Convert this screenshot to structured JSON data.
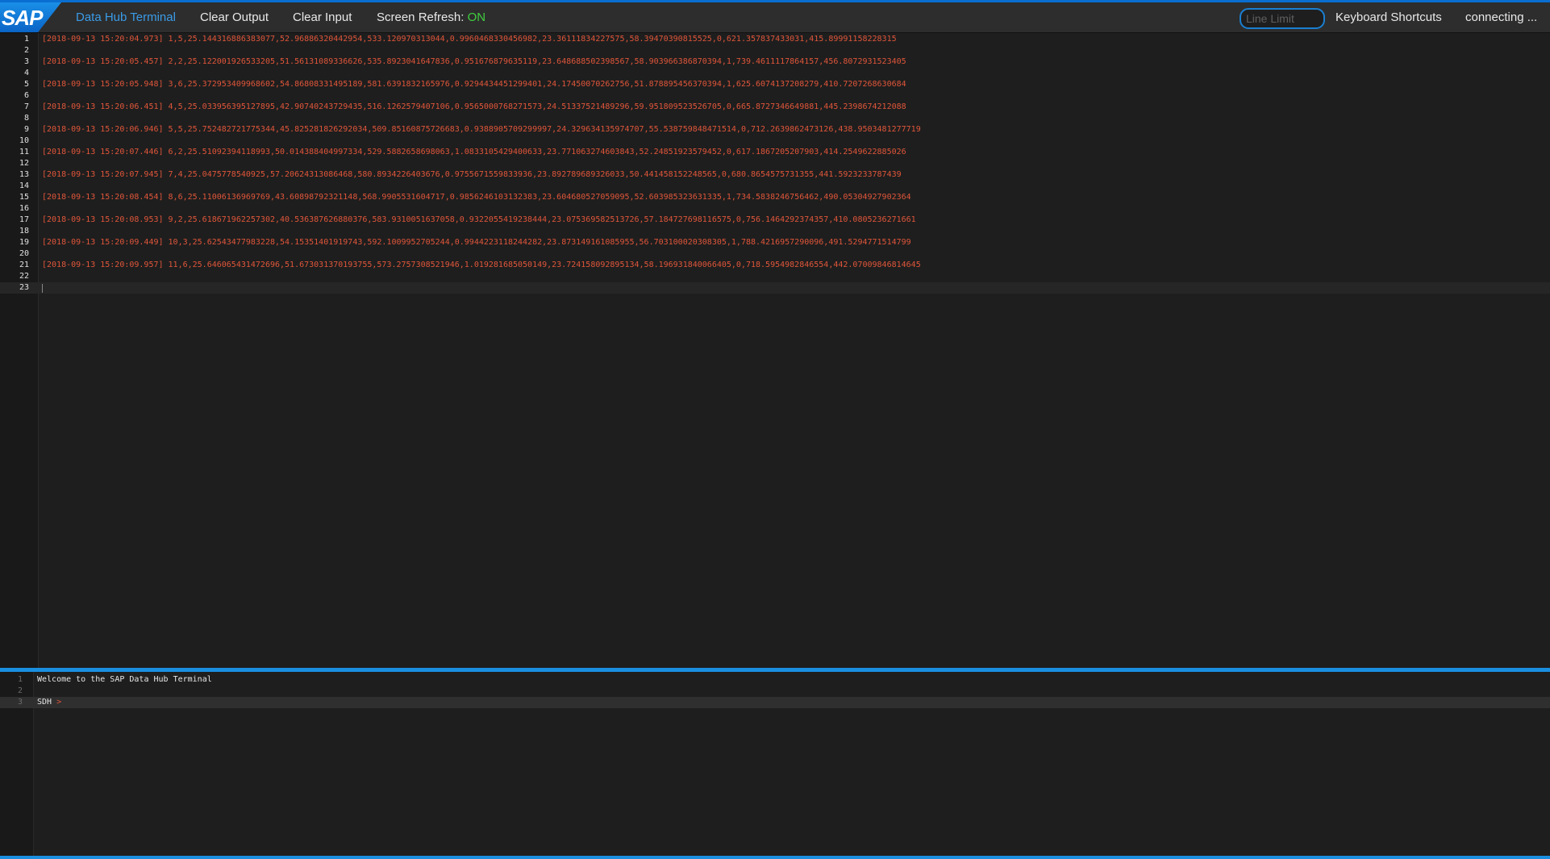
{
  "header": {
    "logo_text": "SAP",
    "title": "Data Hub Terminal",
    "clear_output": "Clear Output",
    "clear_input": "Clear Input",
    "screen_refresh_label": "Screen Refresh:",
    "screen_refresh_value": "ON",
    "line_limit_placeholder": "Line Limit",
    "keyboard_shortcuts": "Keyboard Shortcuts",
    "connection_status": "connecting ..."
  },
  "output": {
    "line_numbers": [
      "1",
      "2",
      "3",
      "4",
      "5",
      "6",
      "7",
      "8",
      "9",
      "10",
      "11",
      "12",
      "13",
      "14",
      "15",
      "16",
      "17",
      "18",
      "19",
      "20",
      "21",
      "22",
      "23"
    ],
    "lines": [
      "[2018-09-13 15:20:04.973] 1,5,25.144316886383077,52.96886320442954,533.120970313044,0.9960468330456982,23.36111834227575,58.39470390815525,0,621.357837433031,415.89991158228315",
      "",
      "[2018-09-13 15:20:05.457] 2,2,25.122001926533205,51.56131089336626,535.8923041647836,0.951676879635119,23.648688502398567,58.903966386870394,1,739.4611117864157,456.8072931523405",
      "",
      "[2018-09-13 15:20:05.948] 3,6,25.372953409968602,54.86808331495189,581.6391832165976,0.9294434451299401,24.17450070262756,51.878895456370394,1,625.6074137208279,410.7207268630684",
      "",
      "[2018-09-13 15:20:06.451] 4,5,25.033956395127895,42.90740243729435,516.1262579407106,0.9565000768271573,24.51337521489296,59.951809523526705,0,665.8727346649881,445.2398674212088",
      "",
      "[2018-09-13 15:20:06.946] 5,5,25.752482721775344,45.825281826292034,509.85160875726683,0.9388905709299997,24.329634135974707,55.538759848471514,0,712.2639862473126,438.9503481277719",
      "",
      "[2018-09-13 15:20:07.446] 6,2,25.51092394118993,50.014388404997334,529.5882658698063,1.0833105429400633,23.771063274603843,52.24851923579452,0,617.1867205207903,414.2549622885026",
      "",
      "[2018-09-13 15:20:07.945] 7,4,25.0475778540925,57.20624313086468,580.8934226403676,0.9755671559833936,23.892789689326033,50.441458152248565,0,680.8654575731355,441.5923233787439",
      "",
      "[2018-09-13 15:20:08.454] 8,6,25.11006136969769,43.60898792321148,568.9905531604717,0.9856246103132383,23.604680527059095,52.603985323631335,1,734.5838246756462,490.05304927902364",
      "",
      "[2018-09-13 15:20:08.953] 9,2,25.618671962257302,40.536387626880376,583.9310051637058,0.9322055419238444,23.075369582513726,57.184727698116575,0,756.1464292374357,410.0805236271661",
      "",
      "[2018-09-13 15:20:09.449] 10,3,25.62543477983228,54.15351401919743,592.1009952705244,0.9944223118244282,23.873149161085955,56.703100020308305,1,788.4216957290096,491.5294771514799",
      "",
      "[2018-09-13 15:20:09.957] 11,6,25.646065431472696,51.673031370193755,573.2757308521946,1.019281685050149,23.724158092895134,58.196931840066405,0,718.5954982846554,442.07009846814645",
      "",
      ""
    ]
  },
  "input": {
    "line_numbers": [
      "1",
      "2",
      "3"
    ],
    "lines": [
      "Welcome to the SAP Data Hub Terminal",
      "",
      "SDH"
    ],
    "prompt_symbol": ">"
  }
}
